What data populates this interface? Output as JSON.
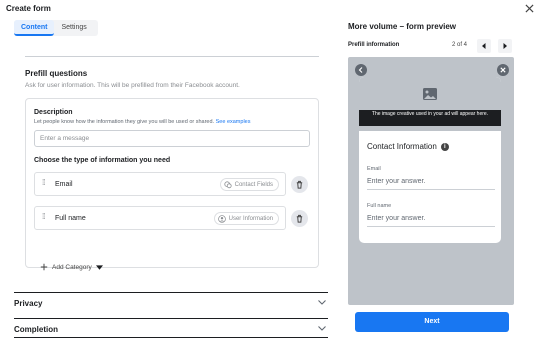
{
  "window": {
    "title": "Create form"
  },
  "tabs": [
    {
      "label": "Content"
    },
    {
      "label": "Settings"
    }
  ],
  "prefill": {
    "title": "Prefill questions",
    "subtitle": "Ask for user information. This will be prefilled from their Facebook account."
  },
  "description": {
    "label": "Description",
    "help": "Let people know how the information they give you will be used or shared.",
    "help_link": "See examples",
    "placeholder": "Enter a message"
  },
  "choose": {
    "label": "Choose the type of information you need"
  },
  "fields": [
    {
      "name": "Email",
      "category": "Contact Fields"
    },
    {
      "name": "Full name",
      "category": "User Information"
    }
  ],
  "add_category": {
    "label": "Add Category"
  },
  "sections": [
    {
      "label": "Privacy"
    },
    {
      "label": "Completion"
    }
  ],
  "preview": {
    "title": "More volume – form preview",
    "nav_label": "Prefill information",
    "page_count": "2 of 4",
    "media_caption": "The image creative used in your ad will appear here.",
    "section_title": "Contact Information",
    "fields": [
      {
        "label": "Email",
        "placeholder": "Enter your answer."
      },
      {
        "label": "Full name",
        "placeholder": "Enter your answer."
      }
    ]
  },
  "next_button": {
    "label": "Next"
  },
  "colors": {
    "accent": "#1877f2",
    "phone_bg": "#bec3c9"
  },
  "icons": [
    "close-icon",
    "grip-icon",
    "chat-bubbles-icon",
    "user-icon",
    "trash-icon",
    "plus-icon",
    "caret-down-icon",
    "chevron-down-icon",
    "chevron-left-icon",
    "chevron-right-icon",
    "back-icon",
    "close-circle-icon",
    "image-icon",
    "info-icon"
  ]
}
